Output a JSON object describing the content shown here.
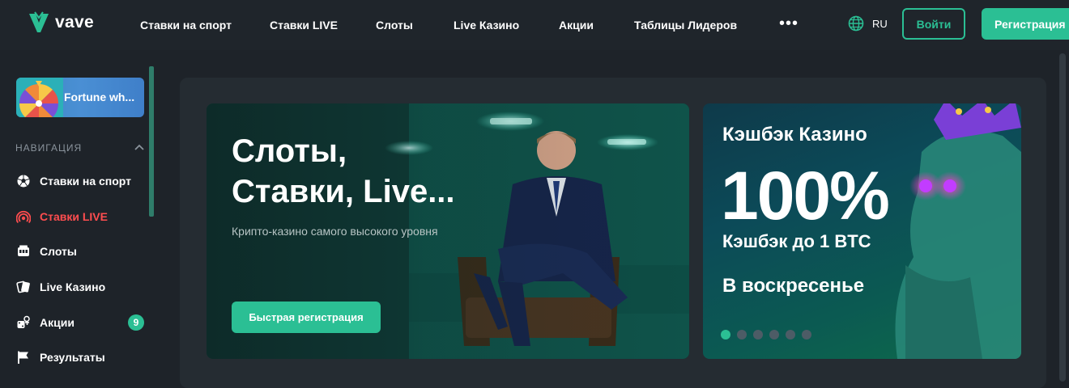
{
  "brand": {
    "name": "vave",
    "accent": "#2bbf94",
    "live_color": "#ff4d4f"
  },
  "header": {
    "nav": [
      "Ставки на спорт",
      "Ставки LIVE",
      "Слоты",
      "Live Казино",
      "Акции",
      "Таблицы Лидеров"
    ],
    "more_icon": "more-dots-icon",
    "language": "RU",
    "login_label": "Войти",
    "register_label": "Регистрация"
  },
  "sidebar": {
    "promo_label": "Fortune wh...",
    "section_heading": "НАВИГАЦИЯ",
    "items": [
      {
        "label": "Ставки на спорт",
        "icon": "soccer-ball-icon"
      },
      {
        "label": "Ставки LIVE",
        "icon": "live-broadcast-icon"
      },
      {
        "label": "Слоты",
        "icon": "slot-machine-icon"
      },
      {
        "label": "Live Казино",
        "icon": "playing-cards-icon"
      },
      {
        "label": "Акции",
        "icon": "promo-dice-icon",
        "badge": "9"
      },
      {
        "label": "Результаты",
        "icon": "flag-icon"
      }
    ]
  },
  "banner_main": {
    "title_line1": "Слоты,",
    "title_line2": "Ставки, Live...",
    "subtitle": "Крипто-казино самого высокого уровня",
    "cta_label": "Быстрая регистрация"
  },
  "banner_cashback": {
    "title": "Кэшбэк Казино",
    "big_value": "100%",
    "line1": "Кэшбэк до 1 BTC",
    "line2": "В воскресенье",
    "slides_total": 6,
    "active_slide": 1
  }
}
